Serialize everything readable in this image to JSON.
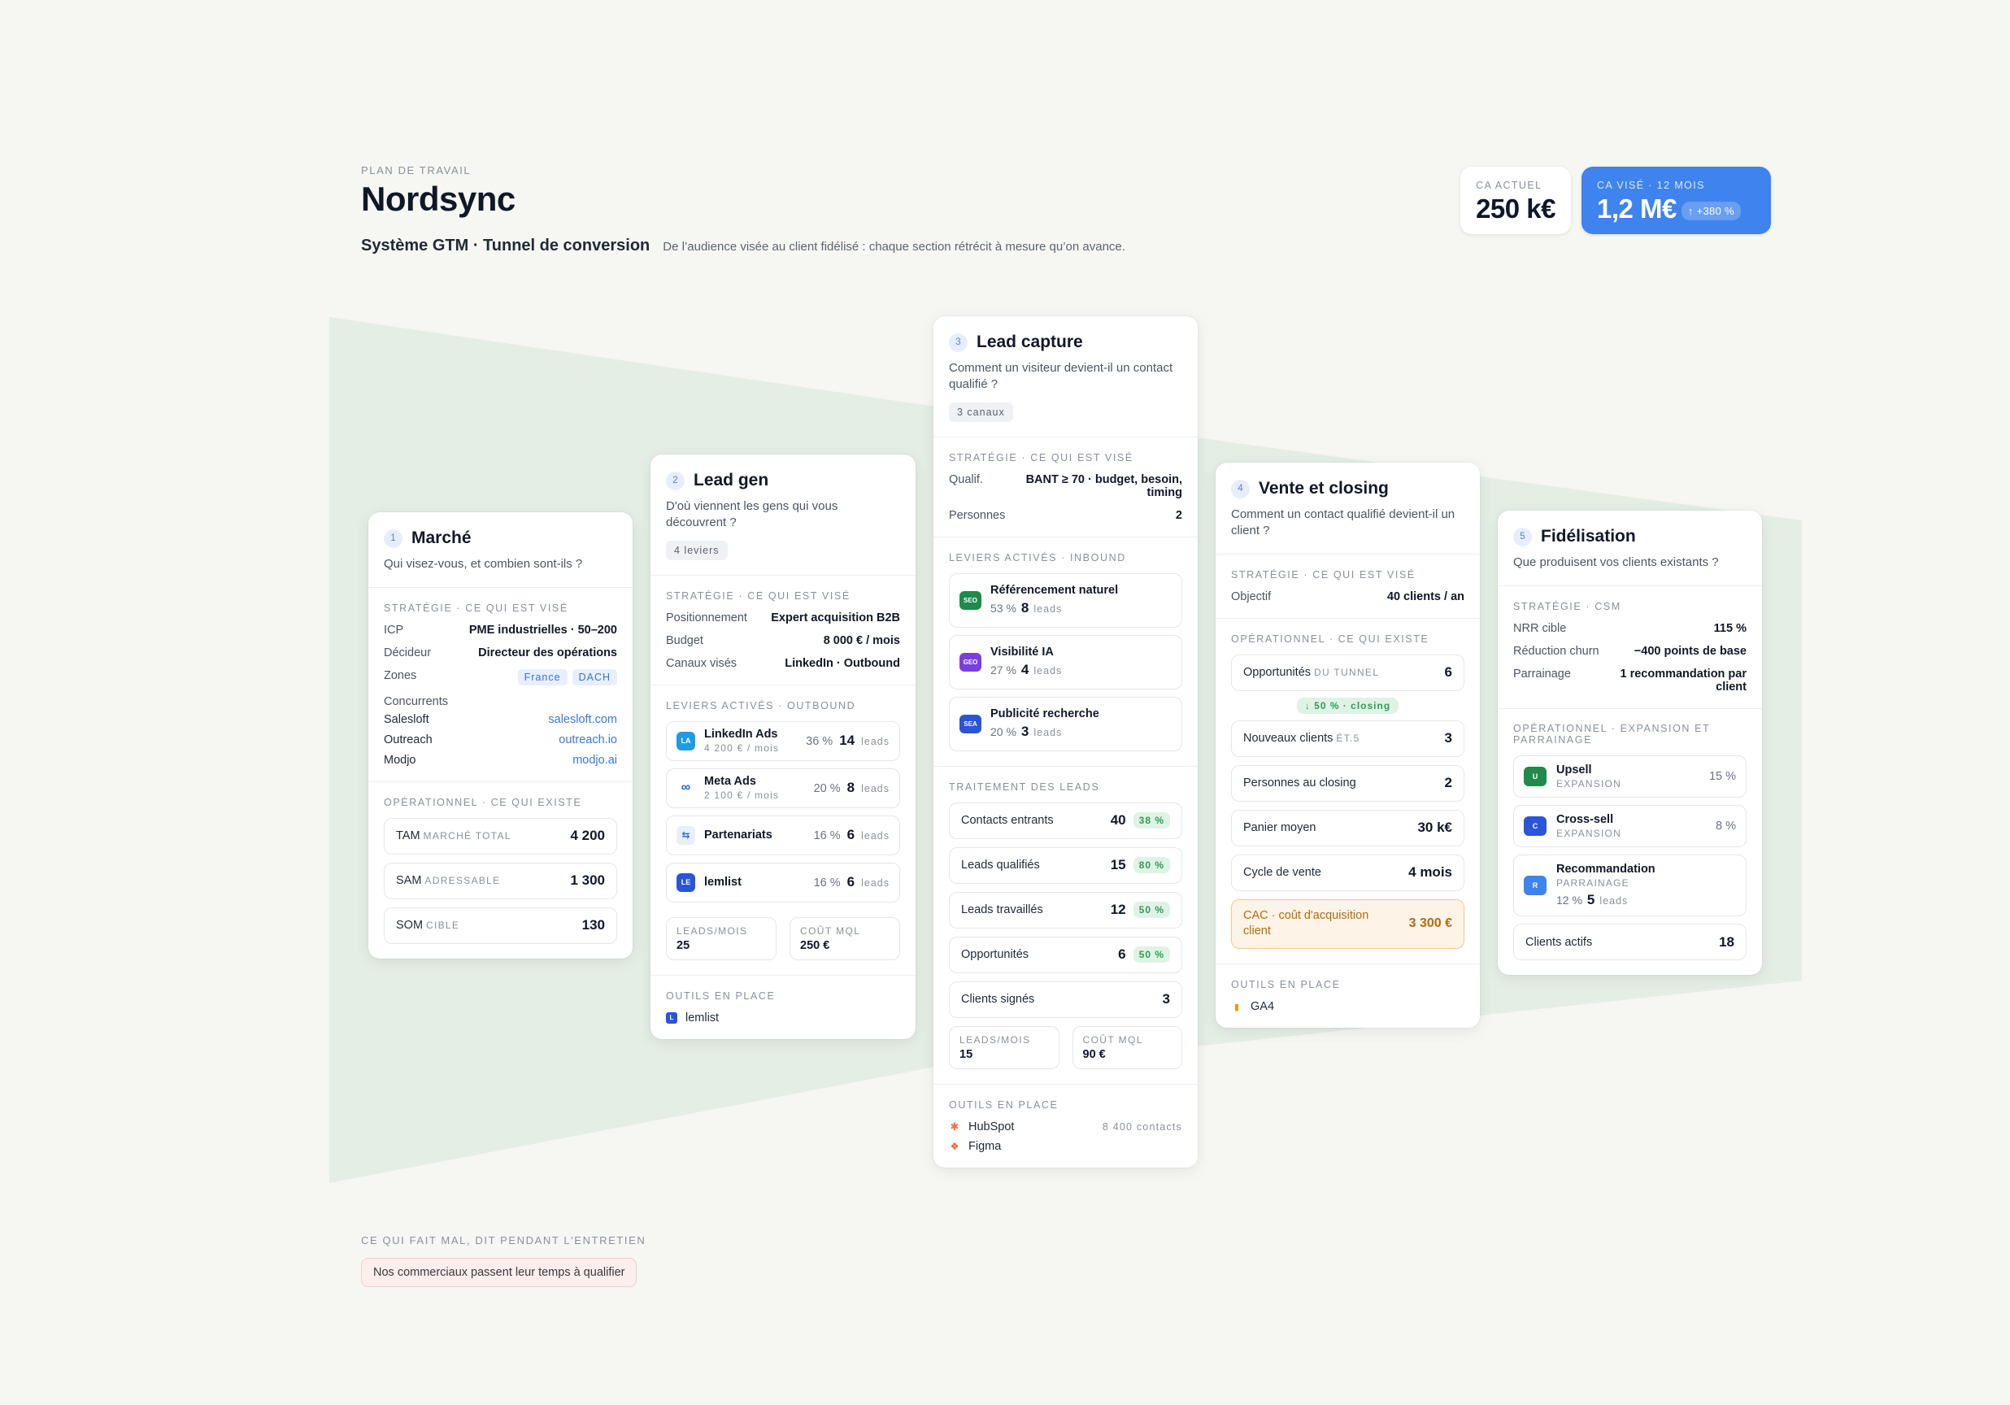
{
  "header": {
    "eyebrow": "PLAN DE TRAVAIL",
    "title": "Nordsync",
    "subtitle": "Système GTM · Tunnel de conversion",
    "description": "De l’audience visée au client fidélisé : chaque section rétrécit à mesure qu’on avance."
  },
  "kpis": {
    "current_label": "CA ACTUEL",
    "current_value": "250 k€",
    "target_label": "CA VISÉ · 12 MOIS",
    "target_value": "1,2 M€",
    "target_growth": "↑ +380 %"
  },
  "colors": {
    "accent": "#3f83ee",
    "funnel": "#e4eee5",
    "success": "#2f9a5a",
    "warning": "#b56a12"
  },
  "cards": {
    "marche": {
      "num": "1",
      "title": "Marché",
      "question": "Qui visez-vous, et combien sont-ils ?",
      "strategy_title": "STRATÉGIE · CE QUI EST VISÉ",
      "icp_k": "ICP",
      "icp_v": "PME industrielles · 50–200",
      "decider_k": "Décideur",
      "decider_v": "Directeur des opérations",
      "zones_k": "Zones",
      "zone1": "France",
      "zone2": "DACH",
      "comp_label": "Concurrents",
      "comps": [
        {
          "name": "Salesloft",
          "url": "salesloft.com"
        },
        {
          "name": "Outreach",
          "url": "outreach.io"
        },
        {
          "name": "Modjo",
          "url": "modjo.ai"
        }
      ],
      "ops_title": "OPÉRATIONNEL · CE QUI EXISTE",
      "metrics": [
        {
          "k": "TAM",
          "s": "MARCHÉ TOTAL",
          "v": "4 200"
        },
        {
          "k": "SAM",
          "s": "ADRESSABLE",
          "v": "1 300"
        },
        {
          "k": "SOM",
          "s": "CIBLE",
          "v": "130"
        }
      ]
    },
    "leadgen": {
      "num": "2",
      "title": "Lead gen",
      "question": "D'où viennent les gens qui vous découvrent ?",
      "pill": "4 leviers",
      "strategy_title": "STRATÉGIE · CE QUI EST VISÉ",
      "kv": [
        {
          "k": "Positionnement",
          "v": "Expert acquisition B2B"
        },
        {
          "k": "Budget",
          "v": "8 000 € / mois"
        },
        {
          "k": "Canaux visés",
          "v": "LinkedIn · Outbound"
        }
      ],
      "levers_title": "LEVIERS ACTIVÉS · OUTBOUND",
      "levers": [
        {
          "icon": "LA",
          "name": "LinkedIn Ads",
          "sub": "4 200 € / mois",
          "pct": "36 %",
          "n": "14",
          "u": "leads"
        },
        {
          "icon": "∞",
          "name": "Meta Ads",
          "sub": "2 100 € / mois",
          "pct": "20 %",
          "n": "8",
          "u": "leads"
        },
        {
          "icon": "⇆",
          "name": "Partenariats",
          "sub": "",
          "pct": "16 %",
          "n": "6",
          "u": "leads"
        },
        {
          "icon": "LE",
          "name": "lemlist",
          "sub": "",
          "pct": "16 %",
          "n": "6",
          "u": "leads"
        }
      ],
      "mini1_l": "LEADS/MOIS",
      "mini1_v": "25",
      "mini2_l": "COÛT MQL",
      "mini2_v": "250 €",
      "tools_title": "OUTILS EN PLACE",
      "tool1": "lemlist"
    },
    "capture": {
      "num": "3",
      "title": "Lead capture",
      "question": "Comment un visiteur devient-il un contact qualifié ?",
      "pill": "3 canaux",
      "strategy_title": "STRATÉGIE · CE QUI EST VISÉ",
      "qualif_k": "Qualif.",
      "qualif_v": "BANT ≥ 70 · budget, besoin, timing",
      "pers_k": "Personnes",
      "pers_v": "2",
      "levers_title": "LEVIERS ACTIVÉS · INBOUND",
      "levers": [
        {
          "icon": "SEO",
          "name": "Référencement naturel",
          "pct": "53 %",
          "n": "8",
          "u": "leads"
        },
        {
          "icon": "GEO",
          "name": "Visibilité IA",
          "pct": "27 %",
          "n": "4",
          "u": "leads"
        },
        {
          "icon": "SEA",
          "name": "Publicité recherche",
          "pct": "20 %",
          "n": "3",
          "u": "leads"
        }
      ],
      "treat_title": "TRAITEMENT DES LEADS",
      "rows": [
        {
          "k": "Contacts entrants",
          "v": "40",
          "p": "38 %"
        },
        {
          "k": "Leads qualifiés",
          "v": "15",
          "p": "80 %"
        },
        {
          "k": "Leads travaillés",
          "v": "12",
          "p": "50 %"
        },
        {
          "k": "Opportunités",
          "v": "6",
          "p": "50 %"
        },
        {
          "k": "Clients signés",
          "v": "3",
          "p": ""
        }
      ],
      "mini1_l": "LEADS/MOIS",
      "mini1_v": "15",
      "mini2_l": "COÛT MQL",
      "mini2_v": "90 €",
      "tools_title": "OUTILS EN PLACE",
      "tool1": "HubSpot",
      "tool1_note": "8 400 contacts",
      "tool2": "Figma"
    },
    "vente": {
      "num": "4",
      "title": "Vente et closing",
      "question": "Comment un contact qualifié devient-il un client ?",
      "strategy_title": "STRATÉGIE · CE QUI EST VISÉ",
      "obj_k": "Objectif",
      "obj_v": "40 clients / an",
      "ops_title": "OPÉRATIONNEL · CE QUI EXISTE",
      "opp_k": "Opportunités",
      "opp_s": "DU TUNNEL",
      "opp_v": "6",
      "closing_pill": "↓ 50 % · closing",
      "rows": [
        {
          "k": "Nouveaux clients",
          "s": "ÉT.5",
          "v": "3"
        },
        {
          "k": "Personnes au closing",
          "s": "",
          "v": "2"
        },
        {
          "k": "Panier moyen",
          "s": "",
          "v": "30 k€"
        },
        {
          "k": "Cycle de vente",
          "s": "",
          "v": "4 mois"
        }
      ],
      "cac_k": "CAC · coût d'acquisition client",
      "cac_v": "3 300 €",
      "tools_title": "OUTILS EN PLACE",
      "tool1": "GA4"
    },
    "fidel": {
      "num": "5",
      "title": "Fidélisation",
      "question": "Que produisent vos clients existants ?",
      "strategy_title": "STRATÉGIE · CSM",
      "kv": [
        {
          "k": "NRR cible",
          "v": "115 %"
        },
        {
          "k": "Réduction churn",
          "v": "−400 points de base"
        },
        {
          "k": "Parrainage",
          "v": "1 recommandation par client"
        }
      ],
      "ops_title": "OPÉRATIONNEL · EXPANSION ET PARRAINAGE",
      "exps": [
        {
          "icon": "U",
          "name": "Upsell",
          "sub": "EXPANSION",
          "pct": "15 %"
        },
        {
          "icon": "C",
          "name": "Cross-sell",
          "sub": "EXPANSION",
          "pct": "8 %"
        }
      ],
      "reco_icon": "R",
      "reco_name": "Recommandation",
      "reco_sub": "PARRAINAGE",
      "reco_pct": "12 %",
      "reco_n": "5",
      "reco_u": "leads",
      "clients_k": "Clients actifs",
      "clients_v": "18"
    }
  },
  "pain": {
    "eyebrow": "CE QUI FAIT MAL, DIT PENDANT L'ENTRETIEN",
    "quote": "Nos commerciaux passent leur temps à qualifier"
  }
}
